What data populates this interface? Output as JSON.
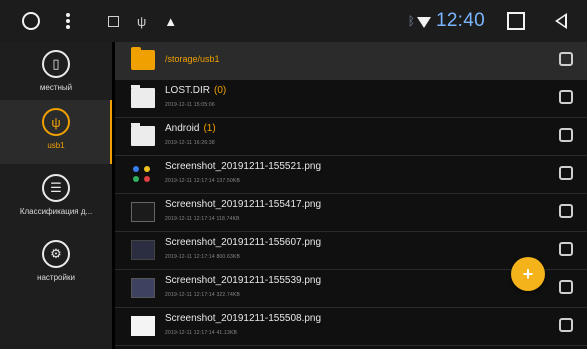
{
  "statusbar": {
    "time": "12:40",
    "icons": [
      "circle-icon",
      "more-dots-icon",
      "image-icon",
      "usb-icon",
      "warning-icon",
      "bluetooth-icon",
      "wifi-icon",
      "recents-square-icon",
      "back-triangle-icon"
    ]
  },
  "sidebar": {
    "items": [
      {
        "label": "местный",
        "icon": "phone-storage-icon",
        "active": false
      },
      {
        "label": "usb1",
        "icon": "usb-icon",
        "active": true
      },
      {
        "label": "Классификация д...",
        "icon": "list-icon",
        "active": false
      },
      {
        "label": "настройки",
        "icon": "gear-icon",
        "active": false
      }
    ]
  },
  "list": {
    "path": "/storage/usb1",
    "rows": [
      {
        "name": "LOST.DIR",
        "count": "(0)",
        "meta": "2019-12-11 15:05:06",
        "type": "folder"
      },
      {
        "name": "Android",
        "count": "(1)",
        "meta": "2019-12-11 16:26:38",
        "type": "folder"
      },
      {
        "name": "Screenshot_20191211-155521.png",
        "count": "",
        "meta": "2019-12-11 12:17:14  137.50KB",
        "type": "image-dots"
      },
      {
        "name": "Screenshot_20191211-155417.png",
        "count": "",
        "meta": "2019-12-11 12:17:14  118.74KB",
        "type": "image-screen"
      },
      {
        "name": "Screenshot_20191211-155607.png",
        "count": "",
        "meta": "2019-12-11 12:17:14  800.63KB",
        "type": "image-dark"
      },
      {
        "name": "Screenshot_20191211-155539.png",
        "count": "",
        "meta": "2019-12-11 12:17:14  322.74KB",
        "type": "image-dark2"
      },
      {
        "name": "Screenshot_20191211-155508.png",
        "count": "",
        "meta": "2019-12-11 12:17:14  41.13KB",
        "type": "image-light"
      }
    ]
  },
  "fab": {
    "label": "+"
  },
  "colors": {
    "accent": "#f0a000",
    "clock": "#79b6ff",
    "fab": "#f5b31b"
  }
}
